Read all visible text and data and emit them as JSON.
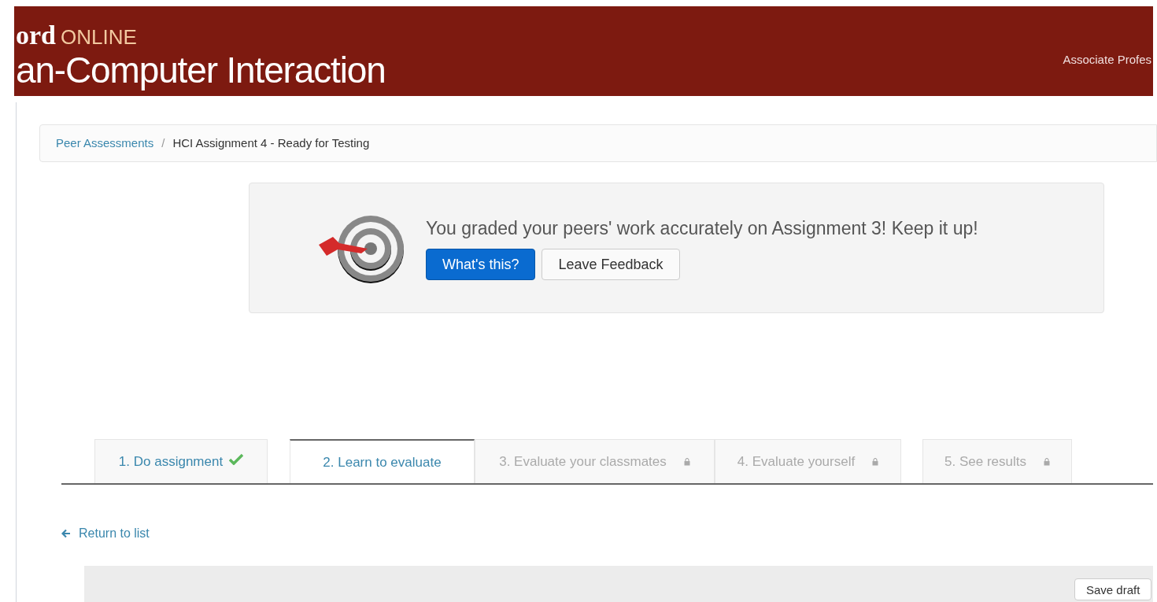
{
  "header": {
    "logo_fragment": "ord",
    "logo_suffix": "ONLINE",
    "course_title": "an-Computer Interaction",
    "user_role": "Associate Profes"
  },
  "breadcrumb_separator": "/",
  "breadcrumb": [
    {
      "label": "Peer Assessments",
      "link": true
    },
    {
      "label": "HCI Assignment 4 - Ready for Testing",
      "link": false
    }
  ],
  "banner": {
    "message": "You graded your peers' work accurately on Assignment 3! Keep it up!",
    "buttons": [
      {
        "label": "What's this?",
        "kind": "primary"
      },
      {
        "label": "Leave Feedback",
        "kind": "default"
      }
    ]
  },
  "steps": [
    {
      "number": "1.",
      "label": "Do assignment",
      "selected": false,
      "completed": true,
      "locked": false
    },
    {
      "number": "2.",
      "label": "Learn to evaluate",
      "selected": true,
      "completed": false,
      "locked": false
    },
    {
      "number": "3.",
      "label": "Evaluate your classmates",
      "selected": false,
      "completed": false,
      "locked": true
    },
    {
      "number": "4.",
      "label": "Evaluate yourself",
      "selected": false,
      "completed": false,
      "locked": true
    },
    {
      "number": "5.",
      "label": "See results",
      "selected": false,
      "completed": false,
      "locked": true
    }
  ],
  "return_link": "Return to list",
  "save_button": "Save draft"
}
